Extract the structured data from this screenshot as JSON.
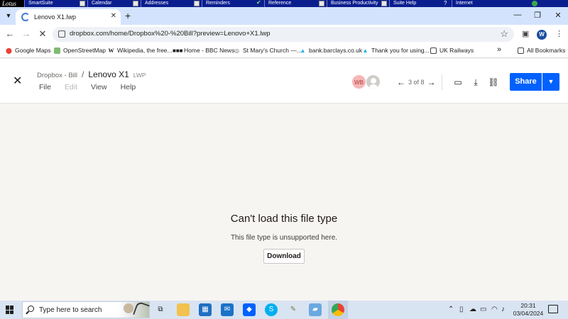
{
  "lotus_bar": {
    "logo": "Lotus",
    "items": [
      "SmartSuite",
      "Calendar",
      "Addresses",
      "Reminders",
      "Reference",
      "Business Productivity",
      "Suite Help",
      "Internet"
    ]
  },
  "browser": {
    "tab_title": "Lenovo X1.lwp",
    "url": "dropbox.com/home/Dropbox%20-%20Bill?preview=Lenovo+X1.lwp",
    "profile_initial": "W",
    "bookmarks": [
      "Google Maps",
      "OpenStreetMap",
      "Wikipedia, the free...",
      "Home - BBC News",
      "St Mary's Church —...",
      "bank.barclays.co.uk",
      "Thank you for using...",
      "UK Railways"
    ],
    "all_bookmarks": "All Bookmarks",
    "overflow": "»"
  },
  "dropbox": {
    "breadcrumb_parent": "Dropbox - Bill",
    "breadcrumb_sep": "/",
    "file_name": "Lenovo X1",
    "file_ext": "LWP",
    "menu": [
      "File",
      "Edit",
      "View",
      "Help"
    ],
    "avatar_initials": "WB",
    "pager": "3 of 8",
    "share_label": "Share",
    "message_title": "Can't load this file type",
    "message_sub": "This file type is unsupported here.",
    "download_label": "Download"
  },
  "taskbar": {
    "search_placeholder": "Type here to search",
    "time": "20:31",
    "date": "03/04/2024"
  },
  "colors": {
    "accent": "#0061fe",
    "tabstrip": "#d3e3fd",
    "lotus": "#0b1e8e"
  }
}
